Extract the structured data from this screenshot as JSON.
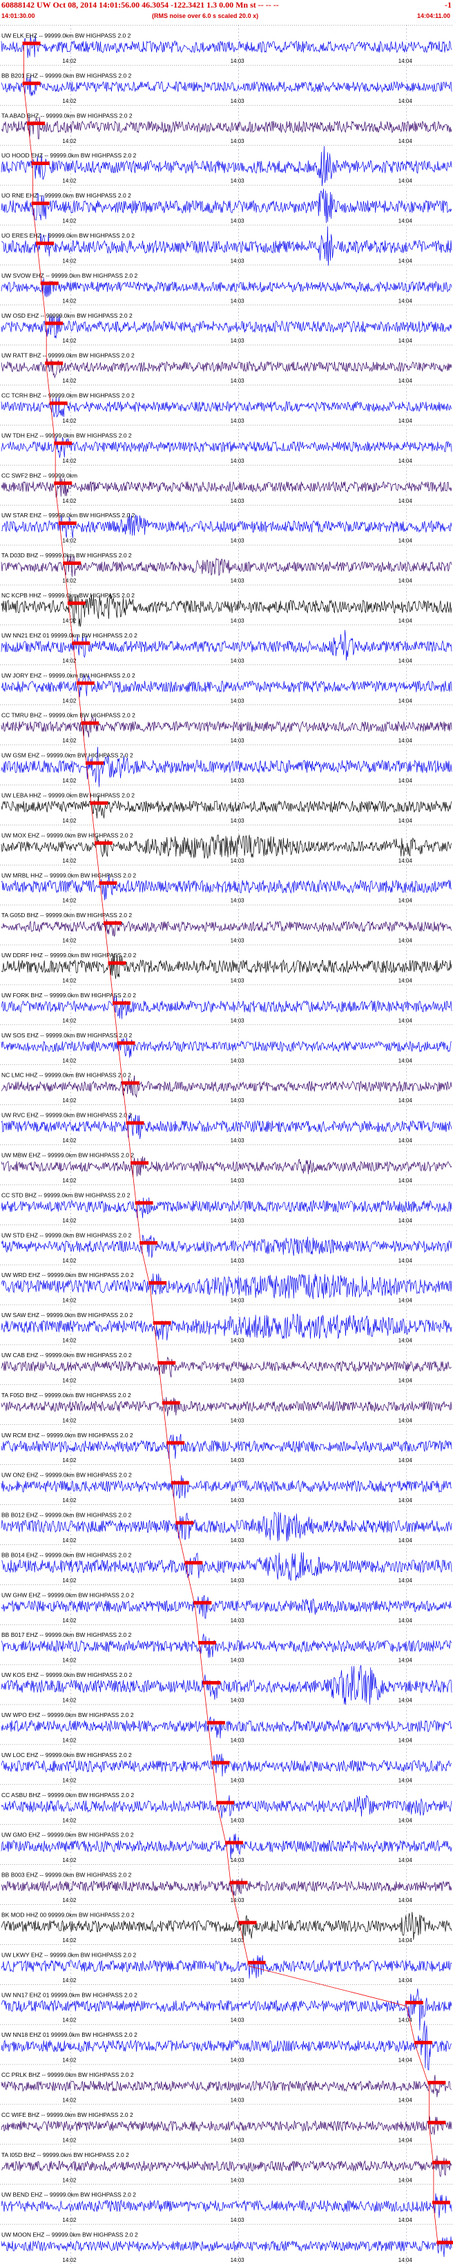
{
  "header": {
    "title": "60888142 UW Oct 08, 2014 14:01:56.00   46.3054 -122.3421  1.3 0.00 Mn st -- -- --",
    "title_end": "-1",
    "start_time": "14:01:30.00",
    "subtitle": "(RMS noise over 6.0 s scaled 20.0 x)",
    "end_time": "14:04:11.00"
  },
  "time_ticks": [
    "14:02",
    "14:03",
    "14:04"
  ],
  "colors": {
    "blue": "#0000ee",
    "purple": "#330066",
    "black": "#000000",
    "red": "#ee0000",
    "grid": "#9999bb"
  },
  "channels": [
    {
      "label": "UW ELK EHZ -- 99999.0km BW  HIGHPASS  2.0  2",
      "color": "blue",
      "amp": 0.45,
      "pick": 0.05,
      "bursts": []
    },
    {
      "label": "BB B201 EHZ -- 99999.0km BW  HIGHPASS  2.0  2",
      "color": "blue",
      "amp": 0.4,
      "pick": 0.05,
      "bursts": []
    },
    {
      "label": "TA ABAD BHZ -- 99999.0km BW  HIGHPASS  2.0  2",
      "color": "purple",
      "amp": 0.45,
      "pick": 0.06,
      "bursts": []
    },
    {
      "label": "UO HOOD EHZ -- 99999.0km BW  HIGHPASS  2.0  2",
      "color": "blue",
      "amp": 0.5,
      "pick": 0.07,
      "bursts": [
        [
          0.7,
          0.74,
          3.5
        ]
      ]
    },
    {
      "label": "UO RNE EHZ -- 99999.0km BW  HIGHPASS  2.0  2",
      "color": "blue",
      "amp": 0.5,
      "pick": 0.07,
      "bursts": [
        [
          0.7,
          0.74,
          3.5
        ]
      ]
    },
    {
      "label": "UO ERES EHZ -- 99999.0km BW  HIGHPASS  2.0  2",
      "color": "blue",
      "amp": 0.5,
      "pick": 0.08,
      "bursts": [
        [
          0.7,
          0.74,
          3.5
        ]
      ]
    },
    {
      "label": "UW SVOW EHZ -- 99999.0km BW  HIGHPASS  2.0  2",
      "color": "blue",
      "amp": 0.4,
      "pick": 0.09,
      "bursts": []
    },
    {
      "label": "UW OSD EHZ -- 99999.0km BW  HIGHPASS  2.0  2",
      "color": "blue",
      "amp": 0.45,
      "pick": 0.1,
      "bursts": []
    },
    {
      "label": "UW RATT BHZ -- 99999.0km BW  HIGHPASS  2.0  2",
      "color": "purple",
      "amp": 0.4,
      "pick": 0.1,
      "bursts": []
    },
    {
      "label": "CC TCRH BHZ -- 99999.0km BW  HIGHPASS  2.0  2",
      "color": "blue",
      "amp": 0.4,
      "pick": 0.11,
      "bursts": []
    },
    {
      "label": "UW TDH EHZ -- 99999.0km BW  HIGHPASS  2.0  2",
      "color": "blue",
      "amp": 0.4,
      "pick": 0.12,
      "bursts": []
    },
    {
      "label": "CC SWF2 BHZ -- 99999.0km",
      "color": "purple",
      "amp": 0.4,
      "pick": 0.12,
      "bursts": []
    },
    {
      "label": "UW STAR EHZ -- 99999.0km BW  HIGHPASS  2.0  2",
      "color": "blue",
      "amp": 0.45,
      "pick": 0.13,
      "bursts": [
        [
          0.26,
          0.33,
          2.5
        ]
      ]
    },
    {
      "label": "TA D03D BHZ -- 99999.0km BW  HIGHPASS  2.0  2",
      "color": "purple",
      "amp": 0.4,
      "pick": 0.14,
      "bursts": [
        [
          0.42,
          0.52,
          1.8
        ]
      ]
    },
    {
      "label": "NC KCPB HHZ -- 99999.0km BW  HIGHPASS  2.0  2",
      "color": "black",
      "amp": 0.5,
      "pick": 0.15,
      "bursts": [
        [
          0.15,
          0.3,
          2
        ]
      ]
    },
    {
      "label": "UW NN21 EHZ 01 99999.0km BW  HIGHPASS  2.0  2",
      "color": "blue",
      "amp": 0.45,
      "pick": 0.16,
      "bursts": [
        [
          0.73,
          0.79,
          3
        ]
      ]
    },
    {
      "label": "UW JORY EHZ -- 99999.0km BW  HIGHPASS  2.0  2",
      "color": "blue",
      "amp": 0.45,
      "pick": 0.17,
      "bursts": []
    },
    {
      "label": "CC TMRU BHZ -- 99999.0km BW  HIGHPASS  2.0  2",
      "color": "purple",
      "amp": 0.4,
      "pick": 0.18,
      "bursts": []
    },
    {
      "label": "UW GSM EHZ -- 99999.0km BW  HIGHPASS  2.0  2",
      "color": "blue",
      "amp": 0.5,
      "pick": 0.19,
      "bursts": [
        [
          0.2,
          0.3,
          2
        ]
      ]
    },
    {
      "label": "UW LEBA HHZ -- 99999.0km BW  HIGHPASS  2.0  2",
      "color": "black",
      "amp": 0.45,
      "pick": 0.2,
      "bursts": []
    },
    {
      "label": "UW MOX EHZ -- 99999.0km BW  HIGHPASS  2.0  2",
      "color": "black",
      "amp": 0.4,
      "pick": 0.21,
      "bursts": [
        [
          0.28,
          0.7,
          2.5
        ],
        [
          0.85,
          0.95,
          2
        ]
      ]
    },
    {
      "label": "UW MRBL HHZ -- 99999.0km BW  HIGHPASS  2.0  2",
      "color": "blue",
      "amp": 0.5,
      "pick": 0.22,
      "bursts": []
    },
    {
      "label": "TA G05D BHZ -- 99999.0km BW  HIGHPASS  2.0  2",
      "color": "purple",
      "amp": 0.4,
      "pick": 0.23,
      "bursts": []
    },
    {
      "label": "UW DDRF HHZ -- 99999.0km BW  HIGHPASS  2.0  2",
      "color": "black",
      "amp": 0.5,
      "pick": 0.24,
      "bursts": []
    },
    {
      "label": "UW FORK BHZ -- 99999.0km BW  HIGHPASS  2.0  2",
      "color": "blue",
      "amp": 0.45,
      "pick": 0.25,
      "bursts": []
    },
    {
      "label": "UW SOS EHZ -- 99999.0km BW  HIGHPASS  2.0  2",
      "color": "blue",
      "amp": 0.4,
      "pick": 0.26,
      "bursts": []
    },
    {
      "label": "NC LMC HHZ -- 99999.0km BW  HIGHPASS  2.0  2",
      "color": "purple",
      "amp": 0.4,
      "pick": 0.27,
      "bursts": []
    },
    {
      "label": "UW RVC EHZ -- 99999.0km BW  HIGHPASS  2.0  2",
      "color": "blue",
      "amp": 0.45,
      "pick": 0.28,
      "bursts": []
    },
    {
      "label": "UW MBW EHZ -- 99999.0km BW  HIGHPASS  2.0  2",
      "color": "purple",
      "amp": 0.4,
      "pick": 0.29,
      "bursts": [
        [
          0.65,
          0.7,
          1.8
        ]
      ]
    },
    {
      "label": "CC STD BHZ -- 99999.0km BW  HIGHPASS  2.0  2",
      "color": "blue",
      "amp": 0.45,
      "pick": 0.3,
      "bursts": []
    },
    {
      "label": "UW STD EHZ -- 99999.0km BW  HIGHPASS  2.0  2",
      "color": "blue",
      "amp": 0.45,
      "pick": 0.31,
      "bursts": [
        [
          0.55,
          0.75,
          1.8
        ]
      ]
    },
    {
      "label": "UW WRD EHZ -- 99999.0km BW  HIGHPASS  2.0  2",
      "color": "blue",
      "amp": 0.5,
      "pick": 0.33,
      "bursts": [
        [
          0.38,
          0.95,
          2
        ]
      ]
    },
    {
      "label": "UW SAW EHZ -- 99999.0km BW  HIGHPASS  2.0  2",
      "color": "blue",
      "amp": 0.5,
      "pick": 0.34,
      "bursts": [
        [
          0.4,
          0.95,
          2
        ]
      ]
    },
    {
      "label": "UW CAB EHZ -- 99999.0km BW  HIGHPASS  2.0  2",
      "color": "purple",
      "amp": 0.4,
      "pick": 0.35,
      "bursts": []
    },
    {
      "label": "TA F05D BHZ -- 99999.0km BW  HIGHPASS  2.0  2",
      "color": "purple",
      "amp": 0.4,
      "pick": 0.36,
      "bursts": []
    },
    {
      "label": "UW RCM EHZ -- 99999.0km BW  HIGHPASS  2.0  2",
      "color": "blue",
      "amp": 0.45,
      "pick": 0.37,
      "bursts": []
    },
    {
      "label": "UW ON2 EHZ -- 99999.0km BW  HIGHPASS  2.0  2",
      "color": "blue",
      "amp": 0.45,
      "pick": 0.38,
      "bursts": []
    },
    {
      "label": "BB B012 EHZ -- 99999.0km BW  HIGHPASS  2.0  2",
      "color": "blue",
      "amp": 0.5,
      "pick": 0.39,
      "bursts": [
        [
          0.55,
          0.7,
          2.5
        ]
      ]
    },
    {
      "label": "BB B014 EHZ -- 99999.0km BW  HIGHPASS  2.0  2",
      "color": "blue",
      "amp": 0.5,
      "pick": 0.41,
      "bursts": [
        [
          0.56,
          0.72,
          2.5
        ]
      ]
    },
    {
      "label": "UW GHW EHZ -- 99999.0km BW  HIGHPASS  2.0  2",
      "color": "blue",
      "amp": 0.45,
      "pick": 0.43,
      "bursts": [
        [
          0.66,
          0.72,
          1.5
        ]
      ]
    },
    {
      "label": "BB B017 EHZ -- 99999.0km BW  HIGHPASS  2.0  2",
      "color": "blue",
      "amp": 0.45,
      "pick": 0.44,
      "bursts": []
    },
    {
      "label": "UW KOS EHZ -- 99999.0km BW  HIGHPASS  2.0  2",
      "color": "blue",
      "amp": 0.5,
      "pick": 0.45,
      "bursts": [
        [
          0.72,
          0.86,
          3.5
        ]
      ]
    },
    {
      "label": "UW WPO EHZ -- 99999.0km BW  HIGHPASS  2.0  2",
      "color": "blue",
      "amp": 0.45,
      "pick": 0.46,
      "bursts": []
    },
    {
      "label": "UW LOC EHZ -- 99999.0km BW  HIGHPASS  2.0  2",
      "color": "blue",
      "amp": 0.45,
      "pick": 0.47,
      "bursts": []
    },
    {
      "label": "CC ASBU BHZ -- 99999.0km BW  HIGHPASS  2.0  2",
      "color": "blue",
      "amp": 0.45,
      "pick": 0.48,
      "bursts": [
        [
          0.78,
          0.83,
          2
        ],
        [
          0.9,
          0.95,
          2
        ]
      ]
    },
    {
      "label": "UW GMO EHZ -- 99999.0km BW  HIGHPASS  2.0  2",
      "color": "blue",
      "amp": 0.45,
      "pick": 0.5,
      "bursts": []
    },
    {
      "label": "BB B003 EHZ -- 99999.0km BW  HIGHPASS  2.0  2",
      "color": "purple",
      "amp": 0.4,
      "pick": 0.51,
      "bursts": []
    },
    {
      "label": "BK MOD HHZ 00 99999.0km BW  HIGHPASS  2.0  2",
      "color": "black",
      "amp": 0.45,
      "pick": 0.53,
      "bursts": [
        [
          0.88,
          0.95,
          2.5
        ]
      ]
    },
    {
      "label": "UW LKWY EHZ -- 99999.0km BW  HIGHPASS  2.0  2",
      "color": "blue",
      "amp": 0.45,
      "pick": 0.55,
      "bursts": []
    },
    {
      "label": "UW NN17 EHZ 01 99999.0km BW  HIGHPASS  2.0  2",
      "color": "blue",
      "amp": 0.45,
      "pick": 0.9,
      "bursts": [
        [
          0.92,
          0.95,
          2.5
        ]
      ]
    },
    {
      "label": "UW NN18 EHZ 01 99999.0km BW  HIGHPASS  2.0  2",
      "color": "blue",
      "amp": 0.45,
      "pick": 0.92,
      "bursts": [
        [
          0.93,
          0.96,
          2.5
        ]
      ]
    },
    {
      "label": "CC PRLK BHZ -- 99999.0km BW  HIGHPASS  2.0  2",
      "color": "purple",
      "amp": 0.4,
      "pick": 0.95,
      "bursts": []
    },
    {
      "label": "CC WIFE BHZ -- 99999.0km BW  HIGHPASS  2.0  2",
      "color": "purple",
      "amp": 0.4,
      "pick": 0.95,
      "bursts": []
    },
    {
      "label": "TA I05D BHZ -- 99999.0km BW  HIGHPASS  2.0  2",
      "color": "purple",
      "amp": 0.4,
      "pick": 0.96,
      "bursts": []
    },
    {
      "label": "UW BEND EHZ -- 99999.0km BW  HIGHPASS  2.0  2",
      "color": "blue",
      "amp": 0.45,
      "pick": 0.96,
      "bursts": []
    },
    {
      "label": "UW MOON EHZ -- 99999.0km BW  HIGHPASS  2.0  2",
      "color": "blue",
      "amp": 0.4,
      "pick": 0.97,
      "bursts": []
    }
  ]
}
